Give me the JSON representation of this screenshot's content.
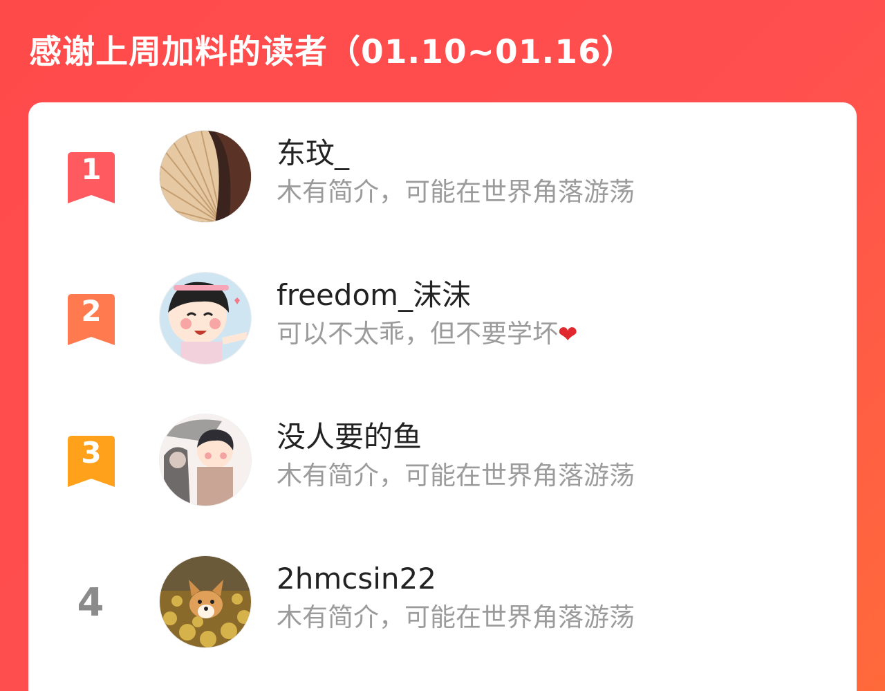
{
  "header": {
    "title": "感谢上周加料的读者（01.10~01.16）"
  },
  "colors": {
    "background": "#ff4a4a",
    "rank1": "#ff5a5f",
    "rank2": "#ff7a4f",
    "rank3": "#ffa11a",
    "rank_plain": "#8b8b8b"
  },
  "readers": [
    {
      "rank": "1",
      "name": "东玟_",
      "bio": "木有简介，可能在世界角落游荡",
      "avatar_icon": "avatar-bamboo-fan-photo"
    },
    {
      "rank": "2",
      "name": "freedom_沫沫",
      "bio": "可以不太乖，但不要学坏",
      "bio_emoji": "❤",
      "avatar_icon": "avatar-cartoon-girl"
    },
    {
      "rank": "3",
      "name": "没人要的鱼",
      "bio": "木有简介，可能在世界角落游荡",
      "avatar_icon": "avatar-anime-boys"
    },
    {
      "rank": "4",
      "name": "2hmcsin22",
      "bio": "木有简介，可能在世界角落游荡",
      "avatar_icon": "avatar-corgi-in-leaves"
    }
  ]
}
